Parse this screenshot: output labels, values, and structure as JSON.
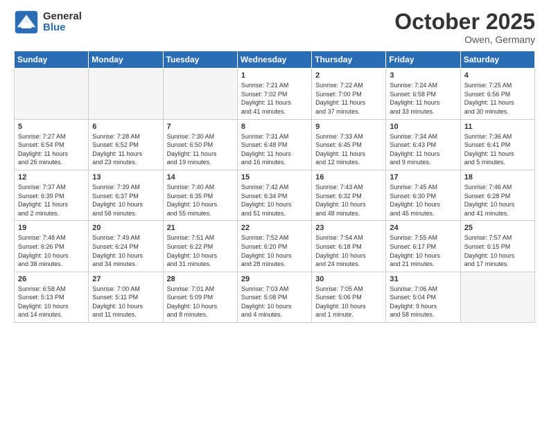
{
  "logo": {
    "general": "General",
    "blue": "Blue"
  },
  "title": "October 2025",
  "location": "Owen, Germany",
  "days": [
    "Sunday",
    "Monday",
    "Tuesday",
    "Wednesday",
    "Thursday",
    "Friday",
    "Saturday"
  ],
  "weeks": [
    [
      {
        "day": "",
        "empty": true
      },
      {
        "day": "",
        "empty": true
      },
      {
        "day": "",
        "empty": true
      },
      {
        "day": "1",
        "lines": [
          "Sunrise: 7:21 AM",
          "Sunset: 7:02 PM",
          "Daylight: 11 hours",
          "and 41 minutes."
        ]
      },
      {
        "day": "2",
        "lines": [
          "Sunrise: 7:22 AM",
          "Sunset: 7:00 PM",
          "Daylight: 11 hours",
          "and 37 minutes."
        ]
      },
      {
        "day": "3",
        "lines": [
          "Sunrise: 7:24 AM",
          "Sunset: 6:58 PM",
          "Daylight: 11 hours",
          "and 33 minutes."
        ]
      },
      {
        "day": "4",
        "lines": [
          "Sunrise: 7:25 AM",
          "Sunset: 6:56 PM",
          "Daylight: 11 hours",
          "and 30 minutes."
        ]
      }
    ],
    [
      {
        "day": "5",
        "lines": [
          "Sunrise: 7:27 AM",
          "Sunset: 6:54 PM",
          "Daylight: 11 hours",
          "and 26 minutes."
        ]
      },
      {
        "day": "6",
        "lines": [
          "Sunrise: 7:28 AM",
          "Sunset: 6:52 PM",
          "Daylight: 11 hours",
          "and 23 minutes."
        ]
      },
      {
        "day": "7",
        "lines": [
          "Sunrise: 7:30 AM",
          "Sunset: 6:50 PM",
          "Daylight: 11 hours",
          "and 19 minutes."
        ]
      },
      {
        "day": "8",
        "lines": [
          "Sunrise: 7:31 AM",
          "Sunset: 6:48 PM",
          "Daylight: 11 hours",
          "and 16 minutes."
        ]
      },
      {
        "day": "9",
        "lines": [
          "Sunrise: 7:33 AM",
          "Sunset: 6:45 PM",
          "Daylight: 11 hours",
          "and 12 minutes."
        ]
      },
      {
        "day": "10",
        "lines": [
          "Sunrise: 7:34 AM",
          "Sunset: 6:43 PM",
          "Daylight: 11 hours",
          "and 9 minutes."
        ]
      },
      {
        "day": "11",
        "lines": [
          "Sunrise: 7:36 AM",
          "Sunset: 6:41 PM",
          "Daylight: 11 hours",
          "and 5 minutes."
        ]
      }
    ],
    [
      {
        "day": "12",
        "lines": [
          "Sunrise: 7:37 AM",
          "Sunset: 6:39 PM",
          "Daylight: 11 hours",
          "and 2 minutes."
        ]
      },
      {
        "day": "13",
        "lines": [
          "Sunrise: 7:39 AM",
          "Sunset: 6:37 PM",
          "Daylight: 10 hours",
          "and 58 minutes."
        ]
      },
      {
        "day": "14",
        "lines": [
          "Sunrise: 7:40 AM",
          "Sunset: 6:35 PM",
          "Daylight: 10 hours",
          "and 55 minutes."
        ]
      },
      {
        "day": "15",
        "lines": [
          "Sunrise: 7:42 AM",
          "Sunset: 6:34 PM",
          "Daylight: 10 hours",
          "and 51 minutes."
        ]
      },
      {
        "day": "16",
        "lines": [
          "Sunrise: 7:43 AM",
          "Sunset: 6:32 PM",
          "Daylight: 10 hours",
          "and 48 minutes."
        ]
      },
      {
        "day": "17",
        "lines": [
          "Sunrise: 7:45 AM",
          "Sunset: 6:30 PM",
          "Daylight: 10 hours",
          "and 45 minutes."
        ]
      },
      {
        "day": "18",
        "lines": [
          "Sunrise: 7:46 AM",
          "Sunset: 6:28 PM",
          "Daylight: 10 hours",
          "and 41 minutes."
        ]
      }
    ],
    [
      {
        "day": "19",
        "lines": [
          "Sunrise: 7:48 AM",
          "Sunset: 6:26 PM",
          "Daylight: 10 hours",
          "and 38 minutes."
        ]
      },
      {
        "day": "20",
        "lines": [
          "Sunrise: 7:49 AM",
          "Sunset: 6:24 PM",
          "Daylight: 10 hours",
          "and 34 minutes."
        ]
      },
      {
        "day": "21",
        "lines": [
          "Sunrise: 7:51 AM",
          "Sunset: 6:22 PM",
          "Daylight: 10 hours",
          "and 31 minutes."
        ]
      },
      {
        "day": "22",
        "lines": [
          "Sunrise: 7:52 AM",
          "Sunset: 6:20 PM",
          "Daylight: 10 hours",
          "and 28 minutes."
        ]
      },
      {
        "day": "23",
        "lines": [
          "Sunrise: 7:54 AM",
          "Sunset: 6:18 PM",
          "Daylight: 10 hours",
          "and 24 minutes."
        ]
      },
      {
        "day": "24",
        "lines": [
          "Sunrise: 7:55 AM",
          "Sunset: 6:17 PM",
          "Daylight: 10 hours",
          "and 21 minutes."
        ]
      },
      {
        "day": "25",
        "lines": [
          "Sunrise: 7:57 AM",
          "Sunset: 6:15 PM",
          "Daylight: 10 hours",
          "and 17 minutes."
        ]
      }
    ],
    [
      {
        "day": "26",
        "lines": [
          "Sunrise: 6:58 AM",
          "Sunset: 5:13 PM",
          "Daylight: 10 hours",
          "and 14 minutes."
        ]
      },
      {
        "day": "27",
        "lines": [
          "Sunrise: 7:00 AM",
          "Sunset: 5:11 PM",
          "Daylight: 10 hours",
          "and 11 minutes."
        ]
      },
      {
        "day": "28",
        "lines": [
          "Sunrise: 7:01 AM",
          "Sunset: 5:09 PM",
          "Daylight: 10 hours",
          "and 8 minutes."
        ]
      },
      {
        "day": "29",
        "lines": [
          "Sunrise: 7:03 AM",
          "Sunset: 5:08 PM",
          "Daylight: 10 hours",
          "and 4 minutes."
        ]
      },
      {
        "day": "30",
        "lines": [
          "Sunrise: 7:05 AM",
          "Sunset: 5:06 PM",
          "Daylight: 10 hours",
          "and 1 minute."
        ]
      },
      {
        "day": "31",
        "lines": [
          "Sunrise: 7:06 AM",
          "Sunset: 5:04 PM",
          "Daylight: 9 hours",
          "and 58 minutes."
        ]
      },
      {
        "day": "",
        "empty": true
      }
    ]
  ]
}
